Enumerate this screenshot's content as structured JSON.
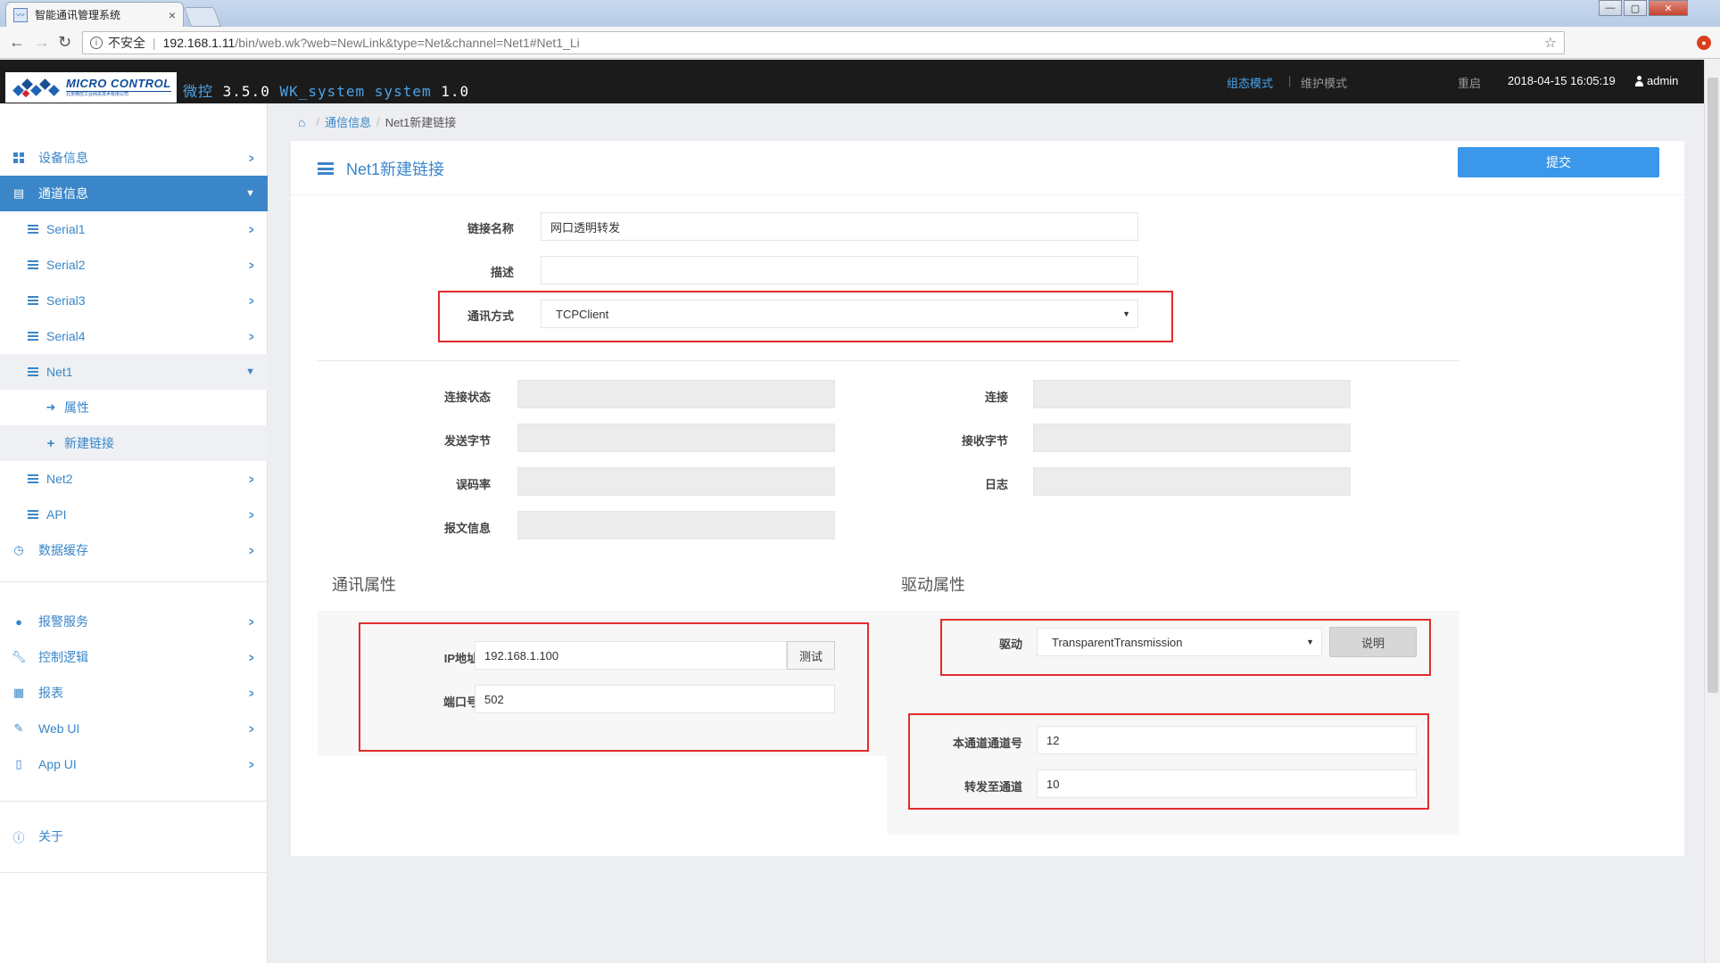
{
  "browser": {
    "tab_title": "智能通讯管理系统",
    "tab_close": "×",
    "insecure_label": "不安全",
    "url_host": "192.168.1.11",
    "url_path": "/bin/web.wk?web=NewLink&type=Net&channel=Net1#Net1_Li"
  },
  "header": {
    "logo_text": "MICRO CONTROL",
    "logo_subtext": "北京微控工业网关技术有限公司",
    "brand": "微控",
    "version": "3.5.0",
    "system_name": "WK_system system",
    "system_version": "1.0",
    "mode_active": "组态模式",
    "divider": "|",
    "mode_maintain": "维护模式",
    "restart": "重启",
    "datetime": "2018-04-15 16:05:19",
    "user": "admin"
  },
  "sidebar": {
    "device_info": "设备信息",
    "channel_info": "通道信息",
    "serial1": "Serial1",
    "serial2": "Serial2",
    "serial3": "Serial3",
    "serial4": "Serial4",
    "net1": "Net1",
    "net1_props": "属性",
    "net1_newlink": "新建链接",
    "net2": "Net2",
    "api": "API",
    "data_cache": "数据缓存",
    "alarm_service": "报警服务",
    "control_logic": "控制逻辑",
    "report": "报表",
    "web_ui": "Web UI",
    "app_ui": "App UI",
    "about": "关于"
  },
  "breadcrumb": {
    "parent": "通信信息",
    "separator": "/",
    "current": "Net1新建链接"
  },
  "panel": {
    "title": "Net1新建链接",
    "submit": "提交"
  },
  "form": {
    "link_name_label": "链接名称",
    "link_name_value": "网口透明转发",
    "desc_label": "描述",
    "desc_value": "",
    "comm_mode_label": "通讯方式",
    "comm_mode_value": "TCPClient",
    "conn_status_label": "连接状态",
    "connect_label": "连接",
    "sent_bytes_label": "发送字节",
    "recv_bytes_label": "接收字节",
    "error_rate_label": "误码率",
    "log_label": "日志",
    "msg_info_label": "报文信息"
  },
  "comm_props": {
    "title": "通讯属性",
    "ip_label": "IP地址",
    "ip_value": "192.168.1.100",
    "test_button": "测试",
    "port_label": "端口号",
    "port_value": "502"
  },
  "driver_props": {
    "title": "驱动属性",
    "driver_label": "驱动",
    "driver_value": "TransparentTransmission",
    "explain_button": "说明",
    "local_channel_label": "本通道通道号",
    "local_channel_value": "12",
    "forward_channel_label": "转发至通道",
    "forward_channel_value": "10"
  },
  "colors": {
    "accent": "#3a86c8",
    "header_bg": "#1b1b1b",
    "highlight_box": "#e22b2b"
  }
}
